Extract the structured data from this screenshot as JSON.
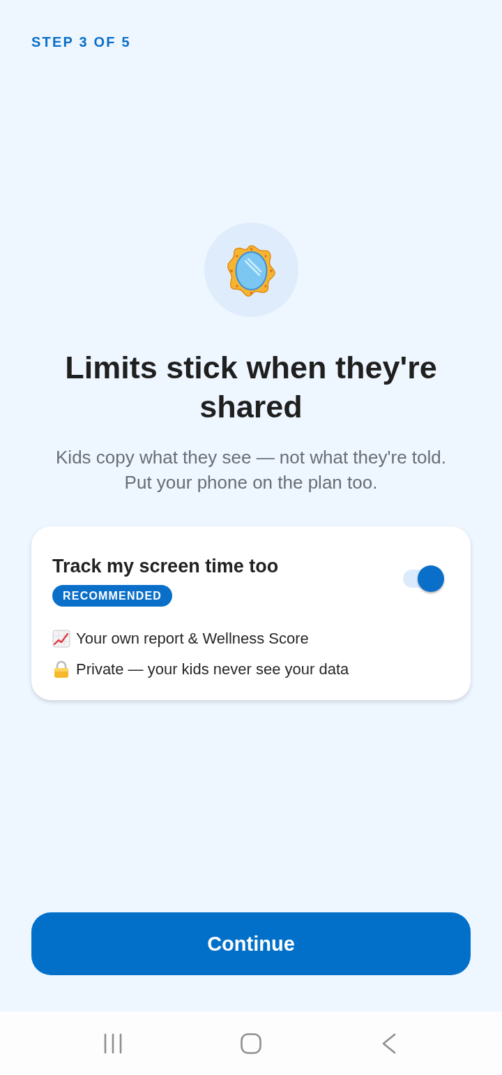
{
  "header": {
    "step_label": "STEP 3 OF 5"
  },
  "hero": {
    "title": "Limits stick when they're shared",
    "subtitle": "Kids copy what they see — not what they're told. Put your phone on the plan too."
  },
  "option_card": {
    "title": "Track my screen time too",
    "badge": "RECOMMENDED",
    "toggle": {
      "on": true
    },
    "benefits": [
      {
        "kind": "chart",
        "text": "Your own report & Wellness Score"
      },
      {
        "kind": "lock",
        "text": "Private — your kids never see your data"
      }
    ]
  },
  "primary_button": {
    "label": "Continue"
  }
}
